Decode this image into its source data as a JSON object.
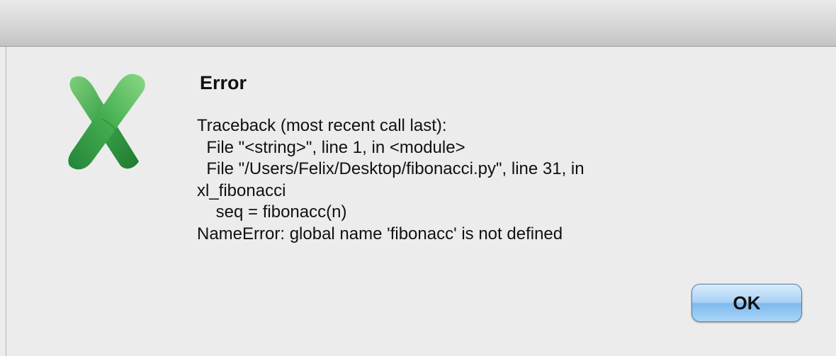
{
  "dialog": {
    "title": "Error",
    "message_lines": [
      "Traceback (most recent call last):",
      "  File \"<string>\", line 1, in <module>",
      "  File \"/Users/Felix/Desktop/fibonacci.py\", line 31, in",
      "xl_fibonacci",
      "    seq = fibonacc(n)",
      "NameError: global name 'fibonacc' is not defined"
    ],
    "ok_label": "OK",
    "icon": "excel-app-icon",
    "colors": {
      "button_blue": "#8cc4f0",
      "icon_green": "#3aa24a",
      "background": "#ececec"
    }
  }
}
